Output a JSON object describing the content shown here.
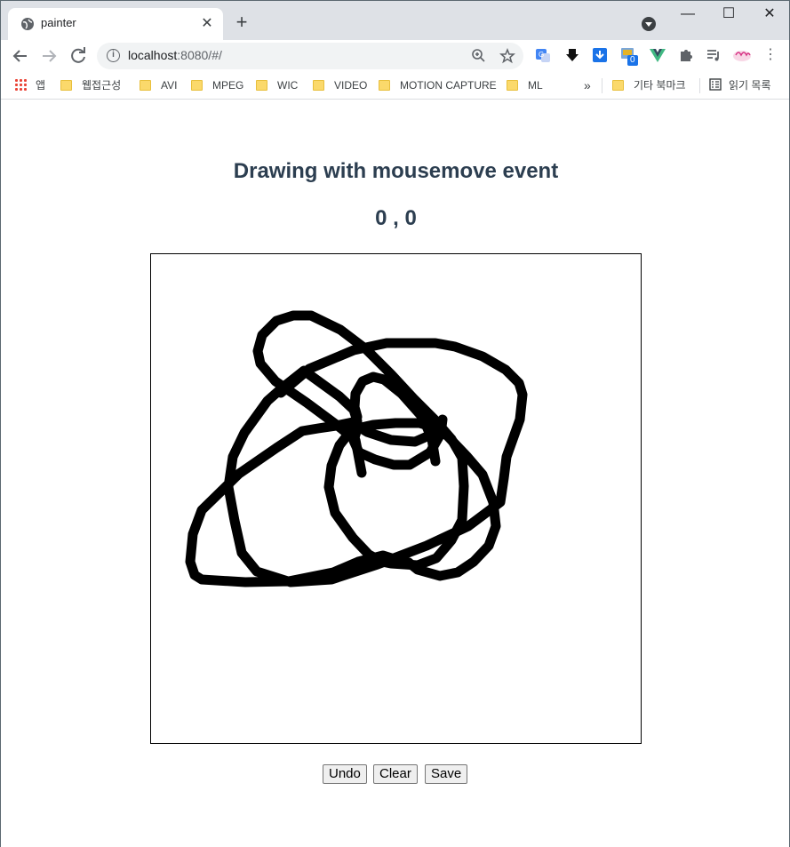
{
  "browser": {
    "tab_title": "painter",
    "tab_close": "✕",
    "new_tab": "+",
    "url_host": "localhost",
    "url_rest": ":8080/#/",
    "window_controls": {
      "minimize": "—",
      "maximize": "☐",
      "close": "✕"
    },
    "bookmarks": {
      "apps": "앱",
      "items": [
        "웹접근성",
        "AVI",
        "MPEG",
        "WIC",
        "VIDEO",
        "MOTION CAPTURE",
        "ML"
      ],
      "overflow": "»",
      "other": "기타 북마크",
      "reading_list": "읽기 목록"
    },
    "extensions": {
      "badge_count": "0"
    }
  },
  "page": {
    "heading": "Drawing with mousemove event",
    "coords": "0 , 0",
    "buttons": {
      "undo": "Undo",
      "clear": "Clear",
      "save": "Save"
    }
  },
  "colors": {
    "heading": "#2c3e50",
    "stroke": "#000000"
  }
}
